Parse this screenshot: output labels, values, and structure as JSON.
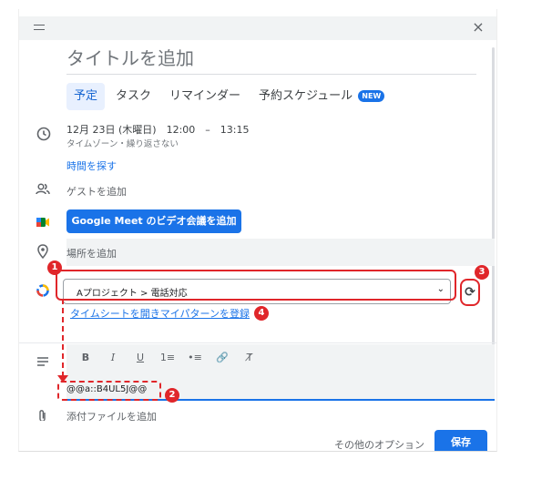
{
  "dialog": {
    "close_label": "×",
    "title_placeholder": "タイトルを追加"
  },
  "tabs": [
    {
      "label": "予定",
      "active": true
    },
    {
      "label": "タスク"
    },
    {
      "label": "リマインダー"
    },
    {
      "label": "予約スケジュール",
      "badge": "NEW"
    }
  ],
  "event": {
    "datetime": "12月 23日 (木曜日)　12:00　–　13:15",
    "sub": "タイムゾーン・繰り返さない",
    "find_time": "時間を探す",
    "guests": "ゲストを追加",
    "meet_button": "Google Meet のビデオ会議を追加",
    "location": "場所を追加",
    "project_select": "Aプロジェクト > 電話対応",
    "timesheet_link": "タイムシートを開きマイパターンを登録",
    "description_value": "@@a::B4UL5J@@",
    "attachment": "添付ファイルを追加"
  },
  "toolbar": {
    "bold": "B",
    "italic": "I",
    "underline": "U",
    "numbered": "1≡",
    "bulleted": "•≡",
    "link": "🔗",
    "clear": "T̸"
  },
  "annotations": [
    "1",
    "2",
    "3",
    "4"
  ],
  "footer": {
    "more_options": "その他のオプション",
    "save": "保存"
  },
  "colors": {
    "accent": "#1a73e8",
    "annotation_red": "#e0262a"
  }
}
